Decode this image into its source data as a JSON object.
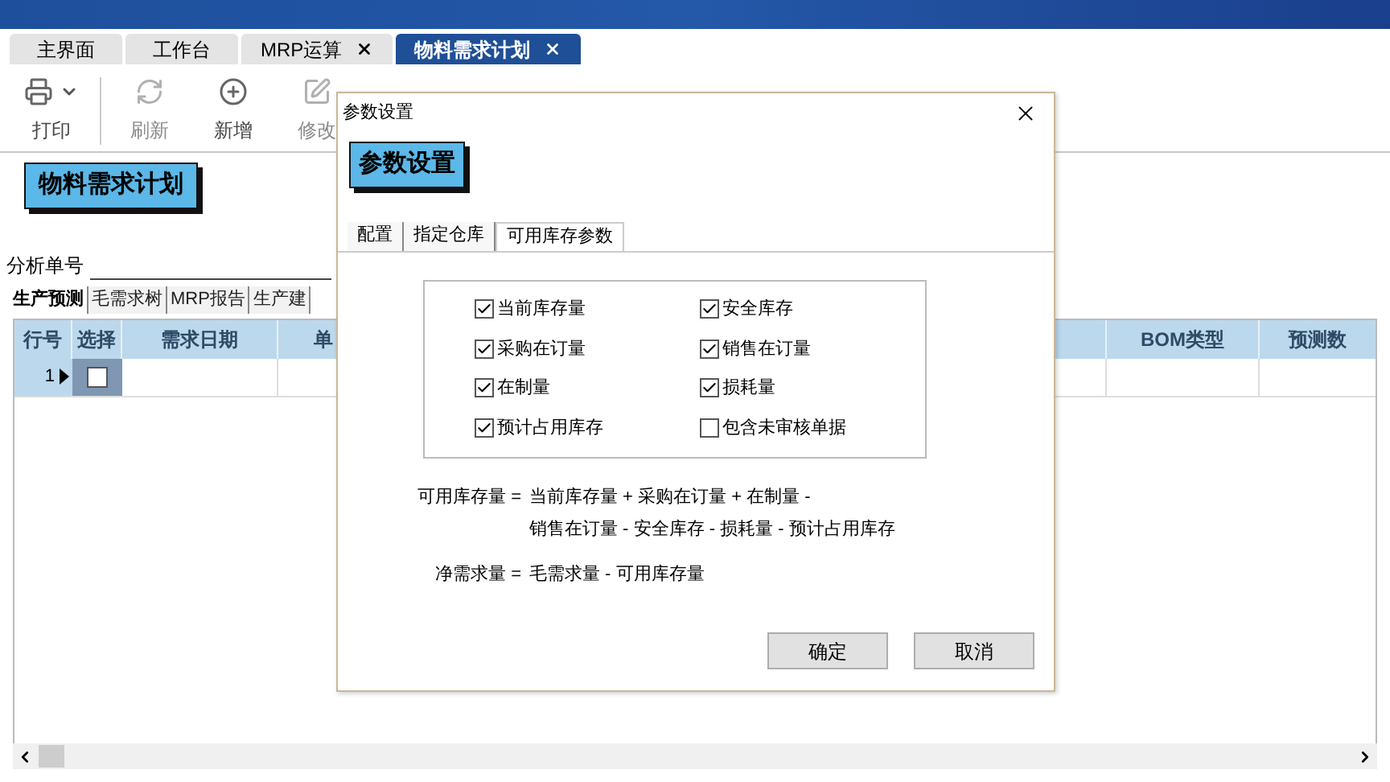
{
  "tabs": [
    {
      "label": "主界面",
      "closable": false,
      "selected": false
    },
    {
      "label": "工作台",
      "closable": false,
      "selected": false
    },
    {
      "label": "MRP运算",
      "closable": true,
      "selected": false
    },
    {
      "label": "物料需求计划",
      "closable": true,
      "selected": true
    }
  ],
  "toolbar": [
    {
      "label": "打印",
      "dropdown": true,
      "disabled": false
    },
    {
      "label": "刷新",
      "dropdown": false,
      "disabled": true
    },
    {
      "label": "新增",
      "dropdown": false,
      "disabled": false
    },
    {
      "label": "修改",
      "dropdown": false,
      "disabled": true
    }
  ],
  "page_title": "物料需求计划",
  "analysis_field": {
    "label": "分析单号"
  },
  "sub_tabs": [
    {
      "label": "生产预测",
      "selected": true
    },
    {
      "label": "毛需求树",
      "selected": false
    },
    {
      "label": "MRP报告",
      "selected": false
    },
    {
      "label": "生产建",
      "selected": false
    }
  ],
  "table": {
    "columns": [
      "行号",
      "选择",
      "需求日期",
      "单",
      "BOM类型",
      "预测数"
    ],
    "rows": [
      {
        "row_number": "1",
        "current": true,
        "checked": false
      }
    ]
  },
  "dialog": {
    "title": "参数设置",
    "heading": "参数设置",
    "tabs": [
      {
        "label": "配置",
        "selected": false
      },
      {
        "label": "指定仓库",
        "selected": false
      },
      {
        "label": "可用库存参数",
        "selected": true
      }
    ],
    "options": [
      {
        "label": "当前库存量",
        "checked": true
      },
      {
        "label": "安全库存",
        "checked": true
      },
      {
        "label": "采购在订量",
        "checked": true
      },
      {
        "label": "销售在订量",
        "checked": true
      },
      {
        "label": "在制量",
        "checked": true
      },
      {
        "label": "损耗量",
        "checked": true
      },
      {
        "label": "预计占用库存",
        "checked": true
      },
      {
        "label": "包含未审核单据",
        "checked": false
      }
    ],
    "formulas": [
      {
        "term": "可用库存量 =",
        "lines": [
          "当前库存量 + 采购在订量 + 在制量 -",
          "销售在订量 - 安全库存 - 损耗量 - 预计占用库存"
        ]
      },
      {
        "term": "净需求量 =",
        "lines": [
          "毛需求量 - 可用库存量"
        ]
      }
    ],
    "buttons": [
      "确定",
      "取消"
    ]
  }
}
